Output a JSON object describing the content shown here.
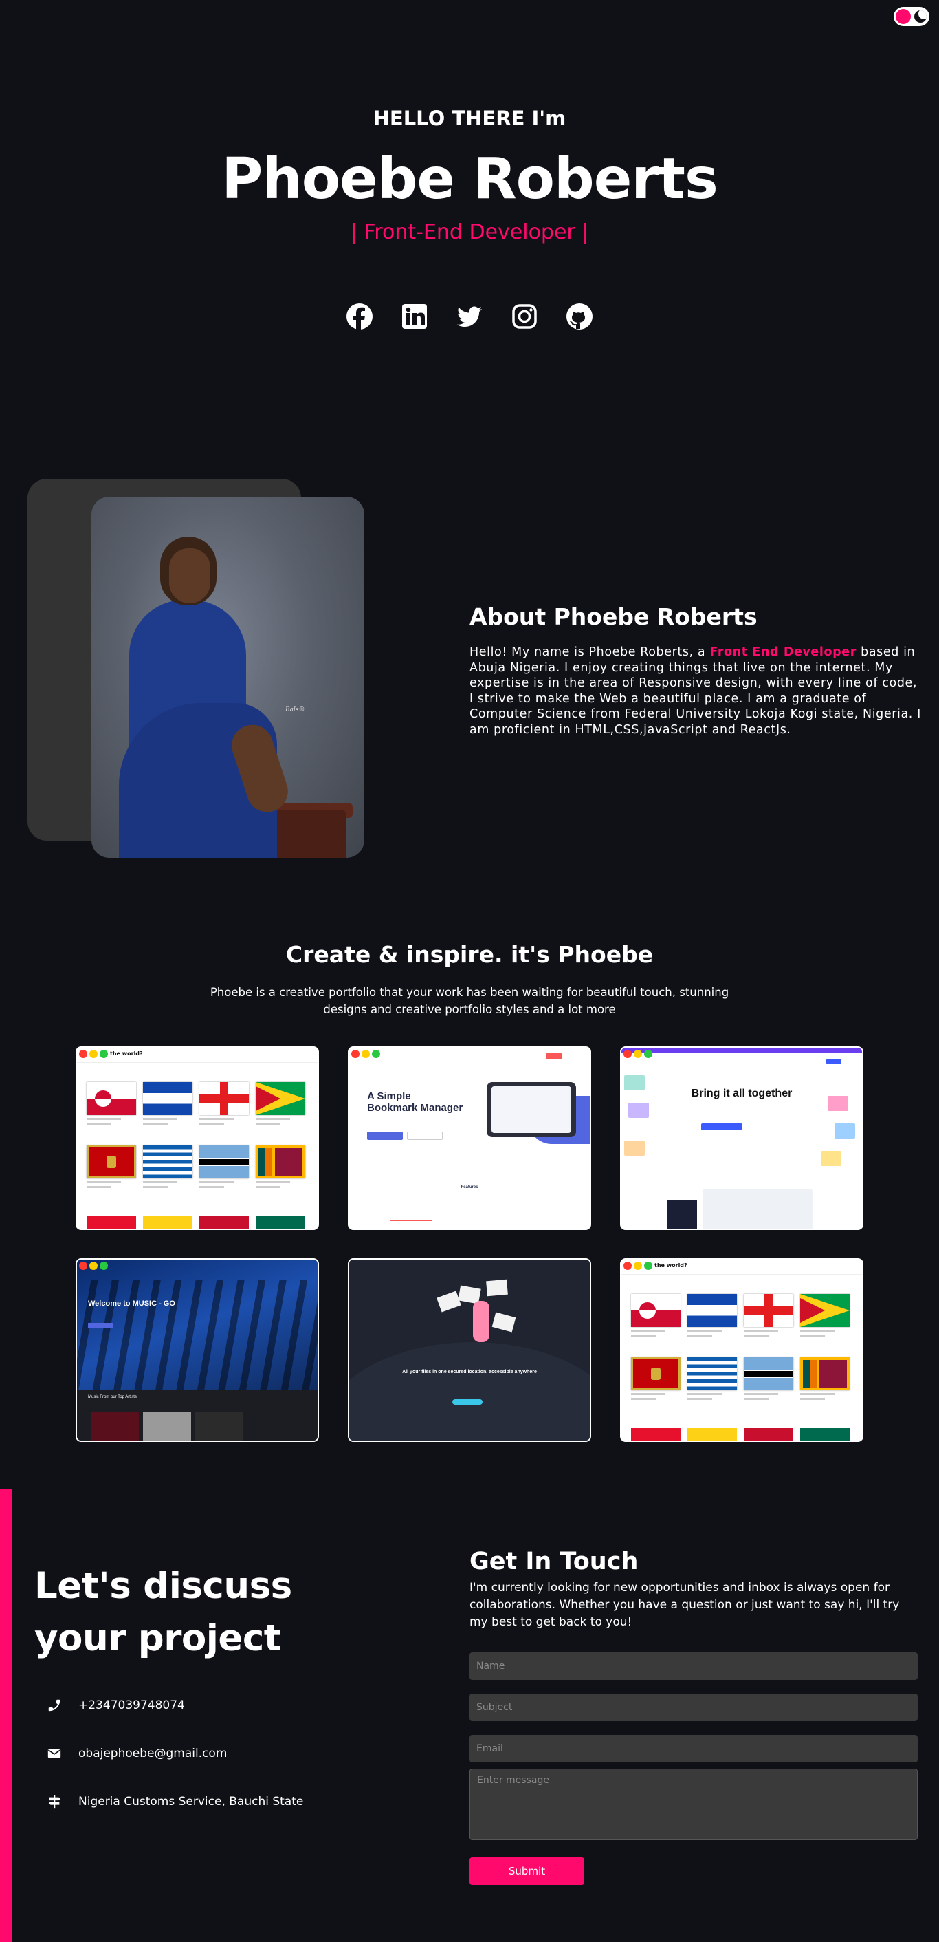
{
  "theme_toggle": {
    "light_icon": "sun-dot-icon",
    "dark_icon": "moon-icon"
  },
  "hero": {
    "greeting": "HELLO THERE I'm",
    "name": "Phoebe Roberts",
    "role": "| Front-End Developer |"
  },
  "socials": [
    {
      "icon": "facebook-icon"
    },
    {
      "icon": "linkedin-icon"
    },
    {
      "icon": "twitter-icon"
    },
    {
      "icon": "instagram-icon"
    },
    {
      "icon": "github-icon"
    }
  ],
  "about": {
    "title": "About Phoebe Roberts",
    "text_before": "Hello! My name is Phoebe Roberts, a ",
    "highlight": "Front End Developer",
    "text_after": " based in Abuja Nigeria. I enjoy creating things that live on the internet. My expertise is in the area of Responsive design, with every line of code, I strive to make the Web a beautiful place. I am a graduate of Computer Science from Federal University Lokoja Kogi state, Nigeria. I am proficient in HTML,CSS,javaScript and ReactJs.",
    "photo_signature": "Bals®"
  },
  "portfolio": {
    "title": "Create & inspire. it's Phoebe",
    "description": "Phoebe is a creative portfolio that your work has been waiting for beautiful touch, stunning designs and creative portfolio styles and a lot more",
    "projects": [
      {
        "name": "countries-project",
        "header": "the world?"
      },
      {
        "name": "bookmark-landing",
        "heading": "A Simple Bookmark Manager",
        "features": "Features"
      },
      {
        "name": "clicky-landing",
        "heading": "Bring it all together"
      },
      {
        "name": "music-go",
        "heading": "Welcome to MUSIC - GO",
        "sub": "Music From our Top Artists"
      },
      {
        "name": "illustration-landing",
        "heading": "All your files in one secured location, accessible anywhere"
      },
      {
        "name": "countries-project-2",
        "header": "the world?"
      }
    ]
  },
  "contact": {
    "title": "Let's discuss your project",
    "phone": "+2347039748074",
    "email": "obajephoebe@gmail.com",
    "address": "Nigeria Customs Service, Bauchi State",
    "form_title": "Get In Touch",
    "form_text": "I'm currently looking for new opportunities and inbox is always open for collaborations. Whether you have a question or just want to say hi, I'll try my best to get back to you!",
    "placeholders": {
      "name": "Name",
      "subject": "Subject",
      "email": "Email",
      "message": "Enter message"
    },
    "submit": "Submit"
  },
  "colors": {
    "accent": "#ff0a6c",
    "background": "#0f1116",
    "field": "#3a3a3a"
  }
}
